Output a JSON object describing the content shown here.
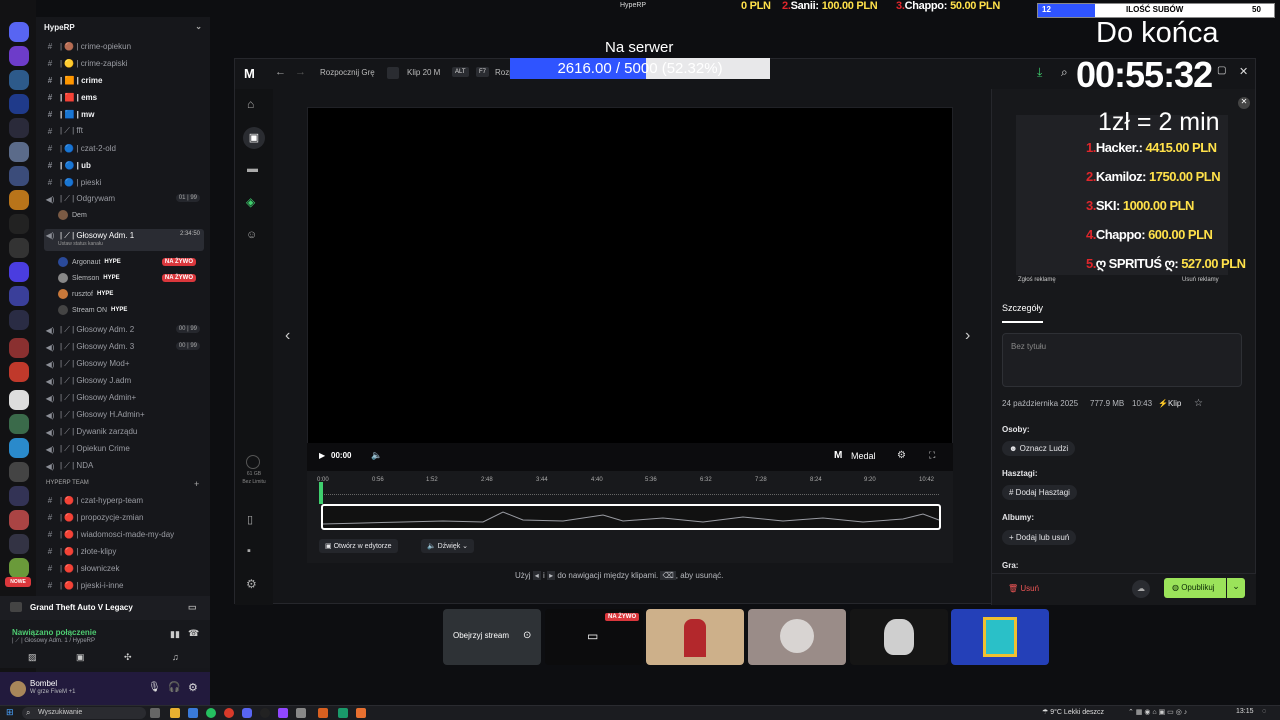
{
  "top_bar": {
    "window_title": "HypeRP"
  },
  "ticker": [
    {
      "rank": "",
      "name": "",
      "amount": "0 PLN"
    },
    {
      "rank": "2.",
      "name": "Sanii:",
      "amount": "100.00 PLN"
    },
    {
      "rank": "3.",
      "name": "Chappo:",
      "amount": "50.00 PLN"
    }
  ],
  "subs_bar": {
    "current": "12",
    "label": "ILOŚĆ SUBÓW",
    "goal": "50",
    "progress": 0.24
  },
  "goal": {
    "title": "Na serwer",
    "text": "2616.00 / 5000 (52.32%)",
    "progress": 0.5232
  },
  "countdown": {
    "label": "Do końca",
    "time": "00:55:32",
    "rate": "1zł = 2 min"
  },
  "donors": [
    {
      "rank": "1.",
      "name": "Hacker.:",
      "amount": "4415.00 PLN"
    },
    {
      "rank": "2.",
      "name": "Kamiloz:",
      "amount": "1750.00 PLN"
    },
    {
      "rank": "3.",
      "name": "SKI:",
      "amount": "1000.00 PLN"
    },
    {
      "rank": "4.",
      "name": "Chappo:",
      "amount": "600.00 PLN"
    },
    {
      "rank": "5.",
      "name": "ღ SPRITUŚ ღ:",
      "amount": "527.00 PLN"
    }
  ],
  "discord": {
    "server_name": "HypeRP",
    "channels": [
      {
        "pre": "#",
        "label": "| 🟤 | crime-opiekun",
        "bold": false
      },
      {
        "pre": "#",
        "label": "| 🟡 | crime-zapiski",
        "bold": false
      },
      {
        "pre": "#",
        "label": "| 🟧 | crime",
        "bold": true
      },
      {
        "pre": "#",
        "label": "| 🟥 | ems",
        "bold": true
      },
      {
        "pre": "#",
        "label": "| 🟦 | mw",
        "bold": true
      },
      {
        "pre": "#",
        "label": "| ⟋ | fft",
        "bold": false
      },
      {
        "pre": "#",
        "label": "| 🔵 | czat-2-old",
        "bold": false
      },
      {
        "pre": "#",
        "label": "| 🔵 | ub",
        "bold": true
      },
      {
        "pre": "#",
        "label": "| 🔵 | pieski",
        "bold": false
      },
      {
        "pre": "🔊",
        "label": "| ⟋ | Odgrywam",
        "bold": false,
        "badge": "01 | 99"
      }
    ],
    "odgrywam_member": "Dem",
    "selected_channel": "| ⟋ | Głosowy Adm. 1",
    "selected_time": "2:34:50",
    "status_hint": "Ustaw status kanału",
    "voice_members": [
      {
        "name": "Argonaut",
        "tag": "HYPE",
        "live": true
      },
      {
        "name": "Slemson",
        "tag": "HYPE",
        "live": true
      },
      {
        "name": "rusztof",
        "tag": "HYPE",
        "live": false
      },
      {
        "name": "Stream ON",
        "tag": "HYPE",
        "live": false
      }
    ],
    "live_label": "NA ŻYWO",
    "channels2": [
      {
        "label": "| ⟋ | Głosowy Adm. 2",
        "badge": "00 | 99"
      },
      {
        "label": "| ⟋ | Głosowy Adm. 3",
        "badge": "00 | 99"
      },
      {
        "label": "| ⟋ | Głosowy Mod+"
      },
      {
        "label": "| ⟋ | Głosowy J.adm"
      },
      {
        "label": "| ⟋ | Głosowy Admin+"
      },
      {
        "label": "| ⟋ | Głosowy H.Admin+"
      },
      {
        "label": "| ⟋ | Dywanik zarządu"
      },
      {
        "label": "| ⟋ | Opiekun Crime"
      },
      {
        "label": "| ⟋ | NDA"
      }
    ],
    "category": "HYPERP TEAM",
    "channels3": [
      "| 🔴 | czat-hyperp-team",
      "| 🔴 | propozycje-zmian",
      "| 🔴 | wiadomosci-made-my-day",
      "| 🔴 | złote-klipy",
      "| 🔴 | słowniczek",
      "| 🔴 | pjeski-i-inne"
    ],
    "game": "Grand Theft Auto V Legacy",
    "voice_status": "Nawiązano połączenie",
    "voice_channel": "| ⟋ | Głosowy Adm. 1 / HypeRP",
    "user_name": "Bombel",
    "user_status": "W grze FiveM +1",
    "rail_new": "NOWE"
  },
  "medal": {
    "nav_items": [
      "Rozpocznij Grę",
      "Klip 20 M",
      "ALT",
      "F7",
      "Rozp"
    ],
    "storage": "61 GB",
    "storage_sub": "Bez Limitu",
    "time": "00:00",
    "brand": "Medal",
    "timeline_ticks": [
      "0:00",
      "0:56",
      "1:52",
      "2:48",
      "3:44",
      "4:40",
      "5:36",
      "6:32",
      "7:28",
      "8:24",
      "9:20",
      "10:42"
    ],
    "open_editor": "Otwórz w edytorze",
    "sound": "Dźwięk",
    "hint_a": "Użyj",
    "hint_b": "i",
    "hint_c": "do nawigacji między klipami.",
    "hint_d": ", aby usunąć.",
    "ad_report": "Zgłoś reklamę",
    "ad_remove": "Usuń reklamy",
    "tab_details": "Szczegóły",
    "title_placeholder": "Bez tytułu",
    "meta_date": "24 października 2025",
    "meta_size": "777.9 MB",
    "meta_time": "10:43",
    "meta_type": "Klip",
    "people_label": "Osoby:",
    "people_btn": "Oznacz Ludzi",
    "tags_label": "Hasztagi:",
    "tags_btn": "Dodaj Hasztagi",
    "albums_label": "Albumy:",
    "albums_btn": "Dodaj lub usuń",
    "game_label": "Gra:",
    "delete_btn": "Usuń",
    "publish_btn": "Opublikuj"
  },
  "stream_thumbs": {
    "watch": "Obejrzyj stream",
    "live": "NA ŻYWO"
  },
  "taskbar": {
    "search": "Wyszukiwanie",
    "weather": "9°C Lekki deszcz",
    "clock": "13:15"
  }
}
